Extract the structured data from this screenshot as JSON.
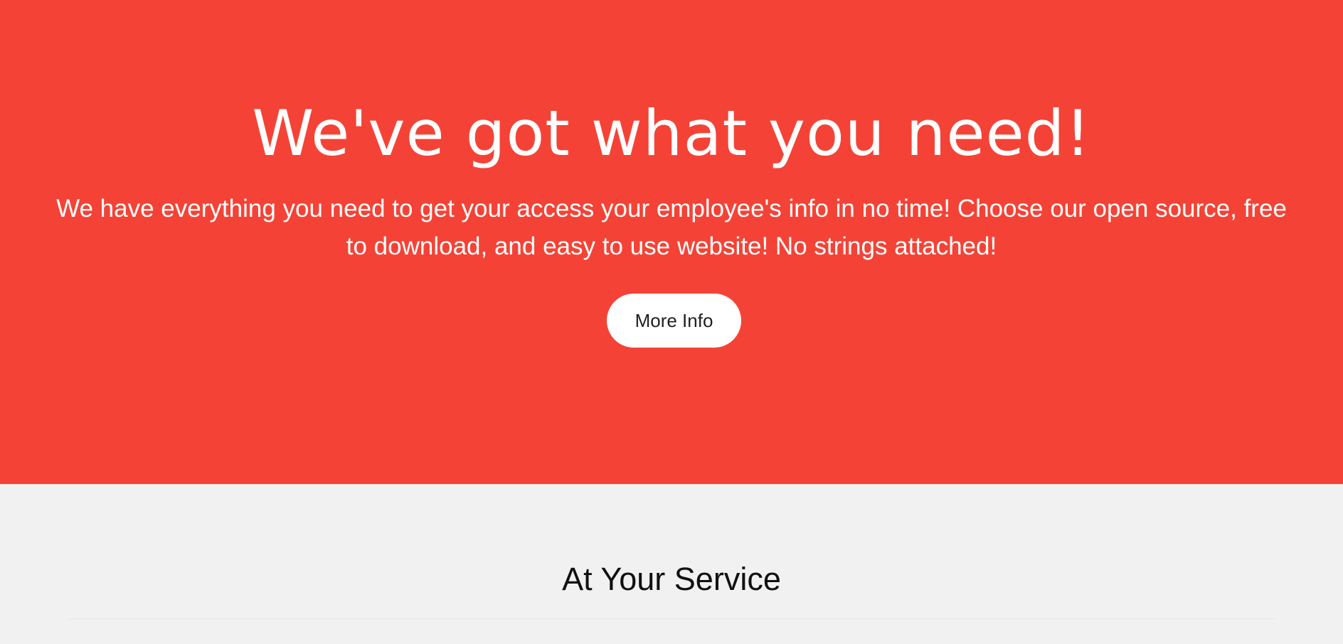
{
  "hero": {
    "title": "We've got what you need!",
    "text": "We have everything you need to get your access your employee's info in no time! Choose our open source, free to download, and easy to use website! No strings attached!",
    "button_label": "More Info",
    "background_color": "#f44336"
  },
  "services": {
    "title": "At Your Service",
    "background_color": "#f1f1f1"
  }
}
